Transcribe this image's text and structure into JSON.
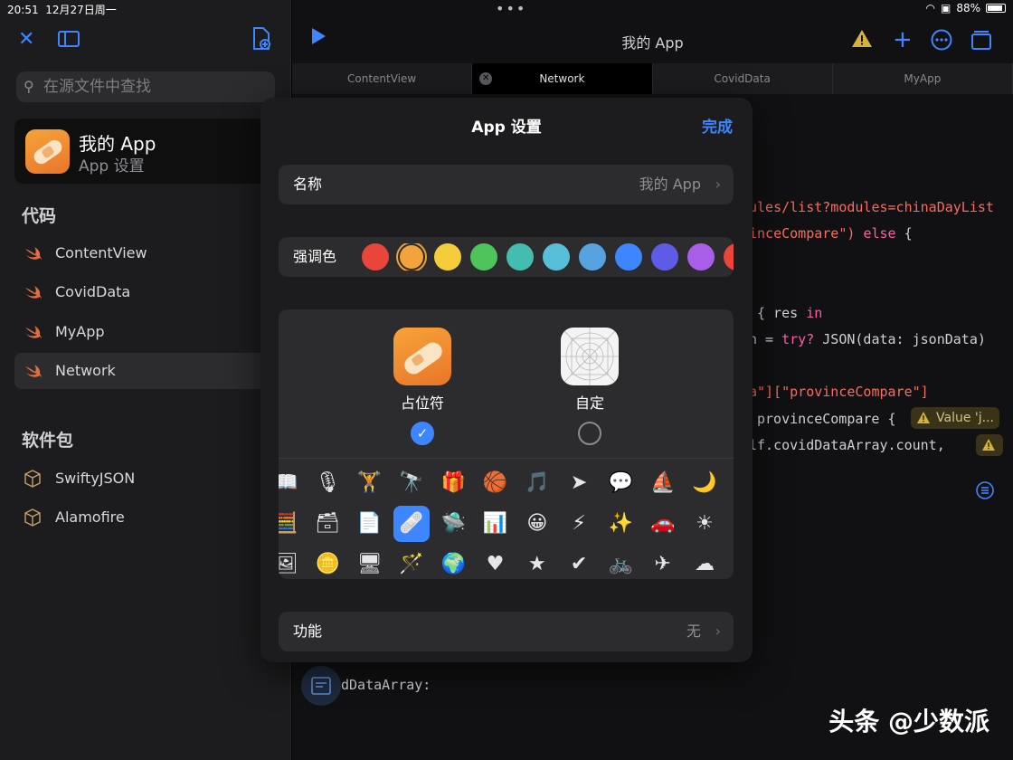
{
  "status_bar": {
    "time": "20:51",
    "date": "12月27日周一",
    "battery": "88%"
  },
  "sidebar": {
    "search_placeholder": "在源文件中查找",
    "app": {
      "name": "我的 App",
      "subtitle": "App 设置"
    },
    "code_section": "代码",
    "code_items": [
      "ContentView",
      "CovidData",
      "MyApp",
      "Network"
    ],
    "active_item": "Network",
    "packages_section": "软件包",
    "packages": [
      "SwiftyJSON",
      "Alamofire"
    ]
  },
  "editor": {
    "title": "我的 App",
    "tabs": [
      "ContentView",
      "Network",
      "CovidData",
      "MyApp"
    ],
    "active_tab": "Network",
    "code": {
      "l1": "ules/list?modules=chinaDayList",
      "l2a": "inceCompare\") ",
      "l2b": "else",
      "l2c": " {",
      "l3a": "{ res ",
      "l3b": "in",
      "l4a": "n = ",
      "l4b": "try?",
      "l4c": " JSON(data: jsonData)",
      "l5": "a\"][\"provinceCompare\"]",
      "l6": "provinceCompare {",
      "l7": "lf.covidDataArray.count,",
      "l8": "dDataArray:"
    },
    "warning_chip": "Value 'j..."
  },
  "modal": {
    "title": "App 设置",
    "done": "完成",
    "name_label": "名称",
    "name_value": "我的 App",
    "accent_label": "强调色",
    "accent_colors": [
      "#e9453b",
      "#f2a33a",
      "#f5cd3a",
      "#4fc45a",
      "#44bcb0",
      "#57c0d8",
      "#56a3e0",
      "#3d86ff",
      "#5e5ce6",
      "#a85ee8",
      "#e9453b"
    ],
    "selected_accent": "#f2a33a",
    "icon_options": [
      {
        "label": "占位符",
        "selected": true
      },
      {
        "label": "自定",
        "selected": false
      }
    ],
    "glyphs": [
      [
        "📖",
        "🎙",
        "🏋",
        "🔭",
        "🎁",
        "🏀",
        "🎵",
        "➤",
        "💬",
        "⛵",
        "🌙"
      ],
      [
        "🧮",
        "🗃",
        "📄",
        "🩹",
        "🛸",
        "📊",
        "😀",
        "⚡",
        "✨",
        "🚗",
        "☀"
      ],
      [
        "🖼",
        "🪙",
        "🖥",
        "🪄",
        "🌍",
        "♥",
        "★",
        "✔",
        "🚲",
        "✈",
        "☁"
      ]
    ],
    "features_label": "功能",
    "features_value": "无"
  },
  "watermark": "头条 @少数派"
}
